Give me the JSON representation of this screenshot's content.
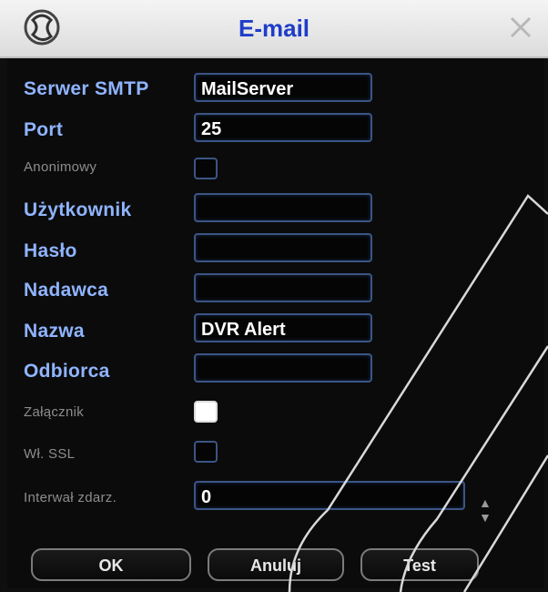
{
  "window": {
    "title": "E-mail",
    "logo_icon": "app-logo-icon",
    "close_icon": "close-icon"
  },
  "form": {
    "smtp_label": "Serwer SMTP",
    "smtp_value": "MailServer",
    "port_label": "Port",
    "port_value": "25",
    "anon_label": "Anonimowy",
    "anon_checked": false,
    "user_label": "Użytkownik",
    "user_value": "",
    "pass_label": "Hasło",
    "pass_value": "",
    "sender_label": "Nadawca",
    "sender_value": "",
    "name_label": "Nazwa",
    "name_value": "DVR Alert",
    "recipient_label": "Odbiorca",
    "recipient_value": "",
    "attach_label": "Załącznik",
    "attach_checked": true,
    "ssl_label": "Wł. SSL",
    "ssl_checked": false,
    "interval_label": "Interwał zdarz.",
    "interval_value": "0"
  },
  "buttons": {
    "ok": "OK",
    "cancel": "Anuluj",
    "test": "Test"
  },
  "colors": {
    "label_accent": "#8fb4ff",
    "title": "#1e3dc8",
    "field_border": "#3b5585"
  }
}
